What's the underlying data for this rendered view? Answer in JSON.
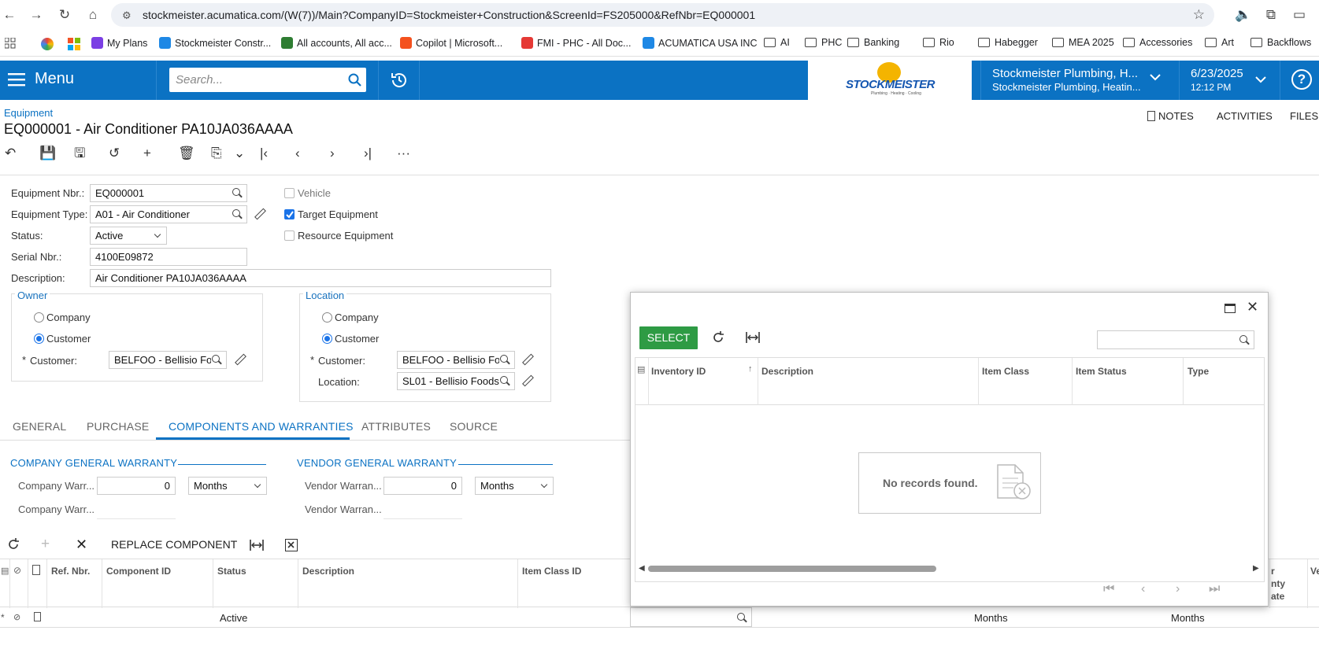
{
  "browser": {
    "url": "stockmeister.acumatica.com/(W(7))/Main?CompanyID=Stockmeister+Construction&ScreenId=FS205000&RefNbr=EQ000001",
    "bookmarks": [
      {
        "label": "My Plans",
        "icon_color": "#7b3fe4"
      },
      {
        "label": "Stockmeister Constr...",
        "icon_color": "#1e88e5"
      },
      {
        "label": "All accounts, All acc...",
        "icon_color": "#2e7d32"
      },
      {
        "label": "Copilot | Microsoft...",
        "icon_color": "#f4511e"
      },
      {
        "label": "FMI - PHC - All Doc...",
        "icon_color": "#e53935"
      },
      {
        "label": "ACUMATICA USA INC",
        "icon_color": "#1e88e5"
      },
      {
        "label": "AI",
        "icon": "folder"
      },
      {
        "label": "PHC",
        "icon": "folder"
      },
      {
        "label": "Banking",
        "icon": "folder"
      },
      {
        "label": "Rio",
        "icon": "folder"
      },
      {
        "label": "Habegger",
        "icon": "folder"
      },
      {
        "label": "MEA 2025",
        "icon": "folder"
      },
      {
        "label": "Accessories",
        "icon": "folder"
      },
      {
        "label": "Art",
        "icon": "folder"
      },
      {
        "label": "Backflows",
        "icon": "folder"
      }
    ]
  },
  "topbar": {
    "menu_label": "Menu",
    "search_placeholder": "Search...",
    "logo_text": "STOCKMEISTER",
    "logo_tagline": "Plumbing · Heating · Cooling",
    "company_line1": "Stockmeister Plumbing, H...",
    "company_line2": "Stockmeister Plumbing, Heatin...",
    "date": "6/23/2025",
    "time": "12:12 PM",
    "accent": "#0b72c3"
  },
  "page": {
    "breadcrumb": "Equipment",
    "title": "EQ000001 - Air Conditioner PA10JA036AAAA",
    "actions": [
      "NOTES",
      "ACTIVITIES",
      "FILES"
    ]
  },
  "form": {
    "equipment_nbr_label": "Equipment Nbr.:",
    "equipment_nbr": "EQ000001",
    "equipment_type_label": "Equipment Type:",
    "equipment_type": "A01 - Air Conditioner",
    "status_label": "Status:",
    "status": "Active",
    "serial_label": "Serial Nbr.:",
    "serial": "4100E09872",
    "description_label": "Description:",
    "description": "Air Conditioner PA10JA036AAAA",
    "vehicle_label": "Vehicle",
    "target_label": "Target Equipment",
    "resource_label": "Resource Equipment",
    "vehicle": false,
    "target": true,
    "resource": false,
    "owner": {
      "title": "Owner",
      "company_label": "Company",
      "customer_label": "Customer",
      "selected": "Customer",
      "customer_field_label": "Customer:",
      "customer": "BELFOO - Bellisio Fo"
    },
    "location": {
      "title": "Location",
      "company_label": "Company",
      "customer_label": "Customer",
      "selected": "Customer",
      "customer_field_label": "Customer:",
      "customer": "BELFOO - Bellisio Fo",
      "location_label": "Location:",
      "location": "SL01 - Bellisio Foods"
    },
    "required_mark": "*"
  },
  "tabs": [
    "GENERAL",
    "PURCHASE",
    "COMPONENTS AND WARRANTIES",
    "ATTRIBUTES",
    "SOURCE"
  ],
  "active_tab": "COMPONENTS AND WARRANTIES",
  "warranty": {
    "company_title": "COMPANY GENERAL WARRANTY",
    "vendor_title": "VENDOR GENERAL WARRANTY",
    "company_duration_label": "Company Warr...",
    "company_type_label": "Company Warr...",
    "vendor_duration_label": "Vendor Warran...",
    "vendor_type_label": "Vendor Warran...",
    "company_value": "0",
    "vendor_value": "0",
    "company_unit": "Months",
    "vendor_unit": "Months"
  },
  "grid": {
    "toolbar_replace": "REPLACE COMPONENT",
    "columns": [
      "Ref. Nbr.",
      "Component ID",
      "Status",
      "Description",
      "Item Class ID"
    ],
    "right_columns_partial": [
      "r",
      "nty",
      "ate",
      "Ve"
    ],
    "row": {
      "status": "Active",
      "unit1": "Months",
      "unit2": "Months"
    }
  },
  "dialog": {
    "select_label": "SELECT",
    "columns": [
      "Inventory ID",
      "Description",
      "Item Class",
      "Item Status",
      "Type"
    ],
    "empty_text": "No records found."
  }
}
